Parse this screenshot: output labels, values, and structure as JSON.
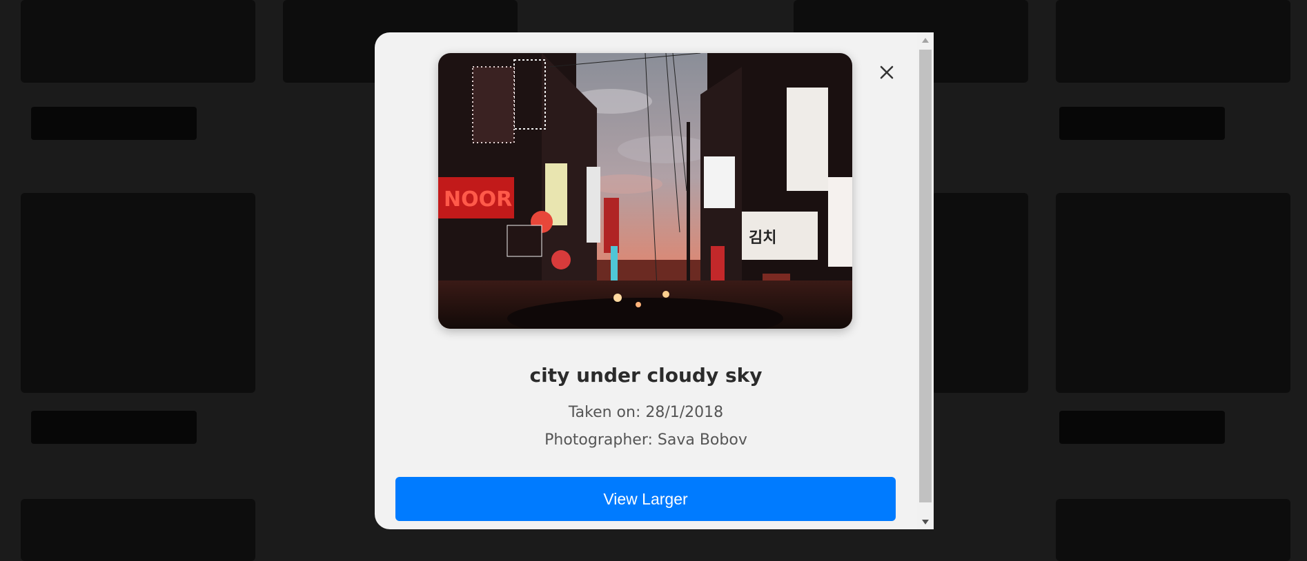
{
  "modal": {
    "title": "city under cloudy sky",
    "taken_on": "Taken on: 28/1/2018",
    "photographer": "Photographer: Sava Bobov",
    "view_button_label": "View Larger",
    "close_icon": "close-icon",
    "image_alt": "city under cloudy sky"
  },
  "colors": {
    "primary_button": "#007bff",
    "modal_background": "#f2f2f2",
    "title_text": "#2b2b2b",
    "meta_text": "#555555"
  }
}
